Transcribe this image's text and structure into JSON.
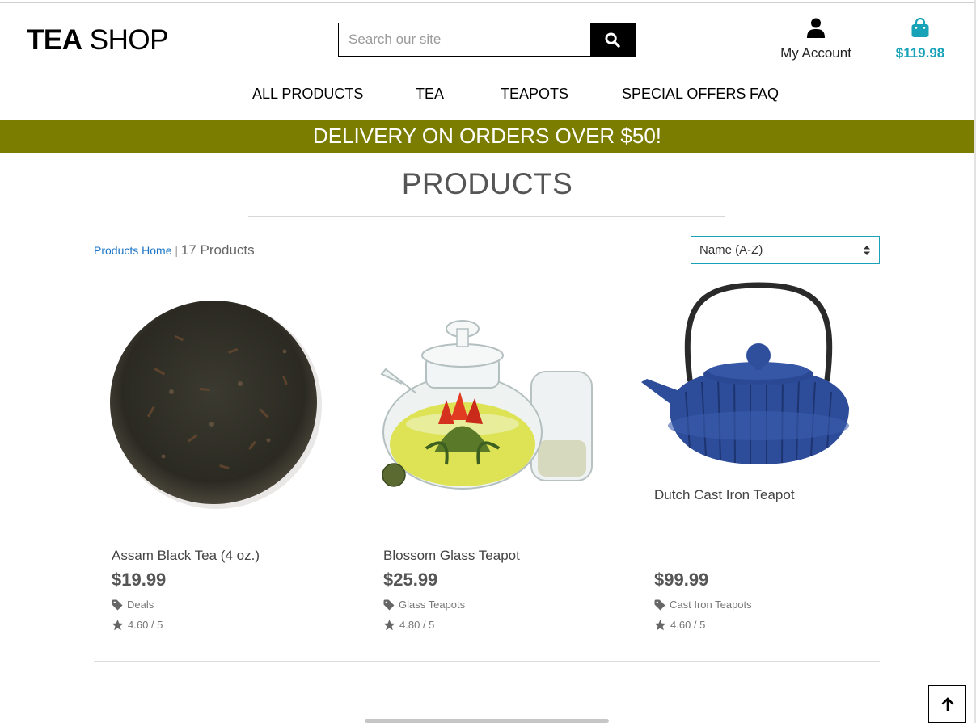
{
  "header": {
    "logo_bold": "TEA",
    "logo_light": "SHOP",
    "search_placeholder": "Search our site",
    "account_label": "My Account",
    "cart_total": "$119.98"
  },
  "nav": {
    "items": [
      "ALL PRODUCTS",
      "TEA",
      "TEAPOTS",
      "SPECIAL OFFERS",
      "FAQ"
    ]
  },
  "banner": "DELIVERY ON ORDERS OVER $50!",
  "page": {
    "title": "PRODUCTS",
    "breadcrumb_link": "Products Home",
    "breadcrumb_sep": "|",
    "product_count": "17 Products",
    "sort_selected": "Name (A-Z)"
  },
  "products": [
    {
      "name": "Assam Black Tea (4 oz.)",
      "price": "$19.99",
      "category": "Deals",
      "rating": "4.60 / 5"
    },
    {
      "name": "Blossom Glass Teapot",
      "price": "$25.99",
      "category": "Glass Teapots",
      "rating": "4.80 / 5"
    },
    {
      "name": "Dutch Cast Iron Teapot",
      "price": "$99.99",
      "category": "Cast Iron Teapots",
      "rating": "4.60 / 5"
    }
  ],
  "colors": {
    "banner": "#7b7d00",
    "accent": "#17a2b8",
    "link": "#1a73c4"
  },
  "icons": {
    "search": "search-icon",
    "account": "user-icon",
    "cart": "shopping-bag-icon",
    "tag": "tag-icon",
    "star": "star-icon",
    "sort": "sort-arrows-icon",
    "to_top": "arrow-up-icon"
  }
}
